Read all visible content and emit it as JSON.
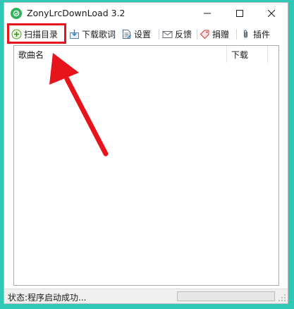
{
  "window": {
    "title": "ZonyLrcDownLoad 3.2",
    "icon": "app-logo-icon"
  },
  "window_controls": {
    "minimize_icon": "minimize-icon",
    "maximize_icon": "maximize-icon",
    "close_icon": "close-icon"
  },
  "toolbar": {
    "items": [
      {
        "label": "扫描目录",
        "icon": "scan-folder-icon"
      },
      {
        "label": "下载歌词",
        "icon": "download-lyrics-icon"
      },
      {
        "label": "设置",
        "icon": "settings-icon"
      },
      {
        "label": "反馈",
        "icon": "feedback-mail-icon"
      },
      {
        "label": "捐赠",
        "icon": "donate-tag-icon"
      },
      {
        "label": "插件",
        "icon": "plugin-clip-icon"
      }
    ]
  },
  "list": {
    "columns": [
      "歌曲名",
      "下载"
    ],
    "rows": []
  },
  "status": {
    "text": "状态:程序启动成功...",
    "progress_percent": 0
  },
  "colors": {
    "desktop": "#2fc7b6",
    "highlight": "#e8141c",
    "arrow": "#e8141c",
    "progress": "#06b025"
  }
}
